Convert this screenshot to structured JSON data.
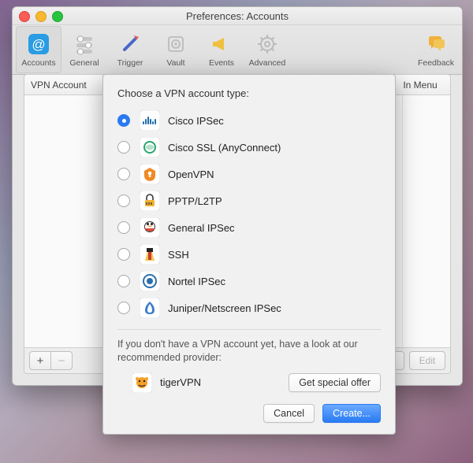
{
  "window": {
    "title": "Preferences: Accounts"
  },
  "toolbar": {
    "tabs": [
      {
        "label": "Accounts",
        "selected": true
      },
      {
        "label": "General",
        "selected": false
      },
      {
        "label": "Trigger",
        "selected": false
      },
      {
        "label": "Vault",
        "selected": false
      },
      {
        "label": "Events",
        "selected": false
      },
      {
        "label": "Advanced",
        "selected": false
      }
    ],
    "feedback_label": "Feedback"
  },
  "account_list": {
    "col_account": "VPN Account",
    "col_menu": "In Menu",
    "buttons": {
      "add": "+",
      "remove": "−",
      "edit": "Edit"
    }
  },
  "sheet": {
    "title": "Choose a VPN account type:",
    "options": [
      {
        "label": "Cisco IPSec",
        "selected": true
      },
      {
        "label": "Cisco SSL (AnyConnect)",
        "selected": false
      },
      {
        "label": "OpenVPN",
        "selected": false
      },
      {
        "label": "PPTP/L2TP",
        "selected": false
      },
      {
        "label": "General IPSec",
        "selected": false
      },
      {
        "label": "SSH",
        "selected": false
      },
      {
        "label": "Nortel IPSec",
        "selected": false
      },
      {
        "label": "Juniper/Netscreen IPSec",
        "selected": false
      }
    ],
    "hint": "If you don't have a VPN account yet, have a look at our recommended provider:",
    "provider": "tigerVPN",
    "offer_button": "Get special offer",
    "cancel": "Cancel",
    "create": "Create..."
  }
}
